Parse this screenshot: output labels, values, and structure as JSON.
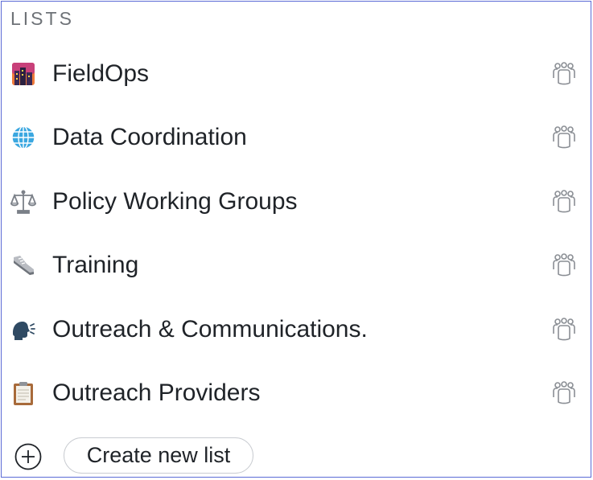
{
  "section": {
    "title": "LISTS"
  },
  "lists": [
    {
      "label": "FieldOps",
      "icon": "cityscape-icon"
    },
    {
      "label": "Data Coordination",
      "icon": "globe-icon"
    },
    {
      "label": "Policy Working Groups",
      "icon": "scales-icon"
    },
    {
      "label": "Training",
      "icon": "sneaker-icon"
    },
    {
      "label": "Outreach & Communications.",
      "icon": "speaking-head-icon"
    },
    {
      "label": "Outreach Providers",
      "icon": "clipboard-icon"
    }
  ],
  "shared_icon": "group-icon",
  "footer": {
    "create_label": "Create new list",
    "add_icon": "plus-circle-icon"
  },
  "colors": {
    "border": "#5b6bd6",
    "text": "#1f2328",
    "muted": "#6e7277"
  }
}
